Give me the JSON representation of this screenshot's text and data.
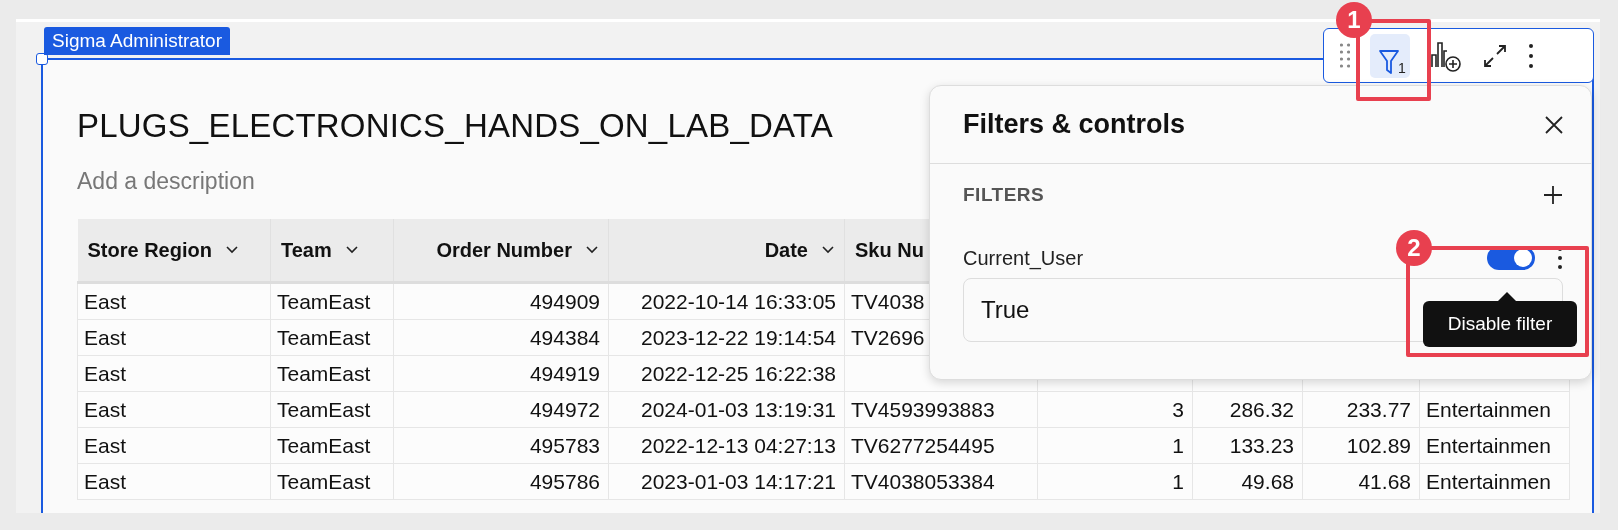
{
  "element_tag": "Sigma Administrator",
  "title": "PLUGS_ELECTRONICS_HANDS_ON_LAB_DATA",
  "description": {
    "placeholder": "Add a description"
  },
  "toolbar": {
    "filter_selected": true,
    "filter_count": "1"
  },
  "table": {
    "columns": [
      {
        "label": "Store Region",
        "menu": true
      },
      {
        "label": "Team",
        "menu": true
      },
      {
        "label": "Order Number",
        "menu": true
      },
      {
        "label": "Date",
        "menu": true
      },
      {
        "label": "Sku Nu"
      },
      {},
      {},
      {},
      {}
    ],
    "rows": [
      [
        "East",
        "TeamEast",
        "494909",
        "2022-10-14 16:33:05",
        "TV4038",
        null,
        null,
        null,
        null
      ],
      [
        "East",
        "TeamEast",
        "494384",
        "2023-12-22 19:14:54",
        "TV2696",
        null,
        null,
        null,
        null
      ],
      [
        "East",
        "TeamEast",
        "494919",
        "2022-12-25 16:22:38",
        null,
        null,
        null,
        null,
        null
      ],
      [
        "East",
        "TeamEast",
        "494972",
        "2024-01-03 13:19:31",
        "TV4593993883",
        "3",
        "286.32",
        "233.77",
        "Entertainmen"
      ],
      [
        "East",
        "TeamEast",
        "495783",
        "2022-12-13 04:27:13",
        "TV6277254495",
        "1",
        "133.23",
        "102.89",
        "Entertainmen"
      ],
      [
        "East",
        "TeamEast",
        "495786",
        "2023-01-03 14:17:21",
        "TV4038053384",
        "1",
        "49.68",
        "41.68",
        "Entertainmen"
      ]
    ]
  },
  "panel": {
    "title": "Filters & controls",
    "section": "FILTERS",
    "filters": [
      {
        "name": "Current_User",
        "enabled": true,
        "value": "True"
      }
    ],
    "tooltip": "Disable filter"
  },
  "annotations": [
    {
      "label": "1"
    },
    {
      "label": "2"
    }
  ]
}
